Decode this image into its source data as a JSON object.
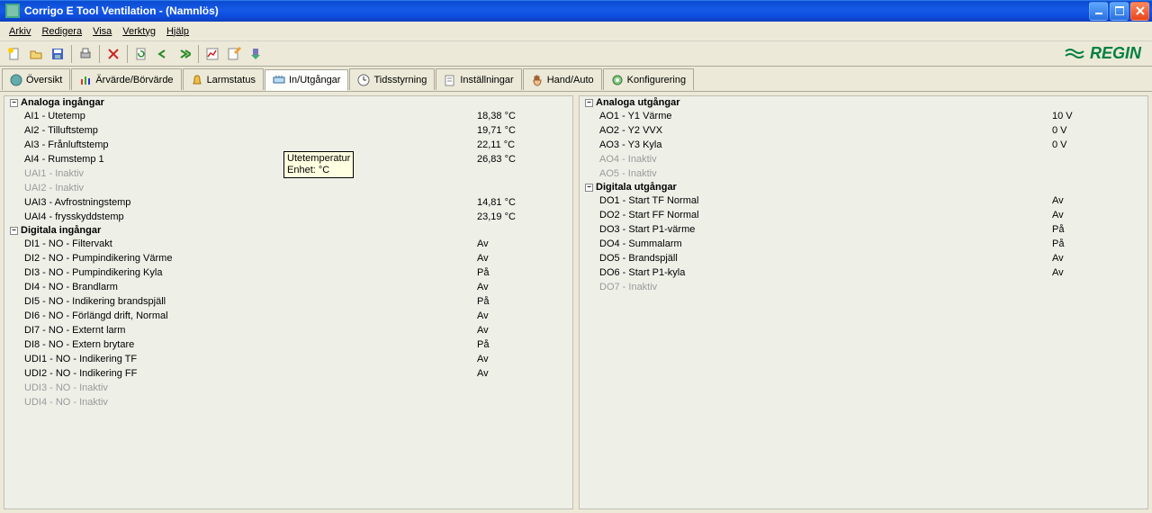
{
  "window": {
    "title": "Corrigo E Tool Ventilation - (Namnlös)"
  },
  "menu": {
    "file": "Arkiv",
    "edit": "Redigera",
    "view": "Visa",
    "tools": "Verktyg",
    "help": "Hjälp"
  },
  "toolbar_icons": [
    "new",
    "open",
    "save",
    "print",
    "delete",
    "refresh",
    "sync-left",
    "sync-right",
    "chart",
    "edit-form",
    "download"
  ],
  "brand": "REGIN",
  "tabs": [
    {
      "label": "Översikt",
      "icon": "overview"
    },
    {
      "label": "Ärvärde/Börvärde",
      "icon": "values"
    },
    {
      "label": "Larmstatus",
      "icon": "alarm"
    },
    {
      "label": "In/Utgångar",
      "icon": "io",
      "active": true
    },
    {
      "label": "Tidsstyrning",
      "icon": "clock"
    },
    {
      "label": "Inställningar",
      "icon": "settings"
    },
    {
      "label": "Hand/Auto",
      "icon": "hand"
    },
    {
      "label": "Konfigurering",
      "icon": "config"
    }
  ],
  "left": {
    "groups": [
      {
        "title": "Analoga ingångar",
        "items": [
          {
            "label": "AI1 - Utetemp",
            "value": "18,38 °C"
          },
          {
            "label": "AI2 - Tilluftstemp",
            "value": "19,71 °C"
          },
          {
            "label": "AI3 - Frånluftstemp",
            "value": "22,11 °C"
          },
          {
            "label": "AI4 - Rumstemp 1",
            "value": "26,83 °C"
          },
          {
            "label": "UAI1 - Inaktiv",
            "value": "",
            "inactive": true
          },
          {
            "label": "UAI2 - Inaktiv",
            "value": "",
            "inactive": true
          },
          {
            "label": "UAI3 - Avfrostningstemp",
            "value": "14,81 °C"
          },
          {
            "label": "UAI4 - frysskyddstemp",
            "value": "23,19 °C"
          }
        ]
      },
      {
        "title": "Digitala ingångar",
        "items": [
          {
            "label": "DI1 - NO - Filtervakt",
            "value": "Av"
          },
          {
            "label": "DI2 - NO - Pumpindikering Värme",
            "value": "Av"
          },
          {
            "label": "DI3 - NO - Pumpindikering Kyla",
            "value": "På"
          },
          {
            "label": "DI4 - NO - Brandlarm",
            "value": "Av"
          },
          {
            "label": "DI5 - NO - Indikering brandspjäll",
            "value": "På"
          },
          {
            "label": "DI6 - NO - Förlängd drift, Normal",
            "value": "Av"
          },
          {
            "label": "DI7 - NO - Externt larm",
            "value": "Av"
          },
          {
            "label": "DI8 - NO - Extern brytare",
            "value": "På"
          },
          {
            "label": "UDI1 - NO - Indikering TF",
            "value": "Av"
          },
          {
            "label": "UDI2 - NO - Indikering FF",
            "value": "Av"
          },
          {
            "label": "UDI3 - NO - Inaktiv",
            "value": "",
            "inactive": true
          },
          {
            "label": "UDI4 - NO - Inaktiv",
            "value": "",
            "inactive": true
          }
        ]
      }
    ]
  },
  "right": {
    "groups": [
      {
        "title": "Analoga utgångar",
        "items": [
          {
            "label": "AO1 - Y1 Värme",
            "value": "10 V"
          },
          {
            "label": "AO2 - Y2 VVX",
            "value": "0 V"
          },
          {
            "label": "AO3 - Y3 Kyla",
            "value": "0 V"
          },
          {
            "label": "AO4 - Inaktiv",
            "value": "",
            "inactive": true
          },
          {
            "label": "AO5 - Inaktiv",
            "value": "",
            "inactive": true
          }
        ]
      },
      {
        "title": "Digitala utgångar",
        "items": [
          {
            "label": "DO1 - Start TF Normal",
            "value": "Av"
          },
          {
            "label": "DO2 - Start FF Normal",
            "value": "Av"
          },
          {
            "label": "DO3 - Start P1-värme",
            "value": "På"
          },
          {
            "label": "DO4 - Summalarm",
            "value": "På"
          },
          {
            "label": "DO5 - Brandspjäll",
            "value": "Av"
          },
          {
            "label": "DO6 - Start P1-kyla",
            "value": "Av"
          },
          {
            "label": "DO7 - Inaktiv",
            "value": "",
            "inactive": true
          }
        ]
      }
    ]
  },
  "tooltip": {
    "line1": "Utetemperatur",
    "line2": "Enhet: °C"
  }
}
